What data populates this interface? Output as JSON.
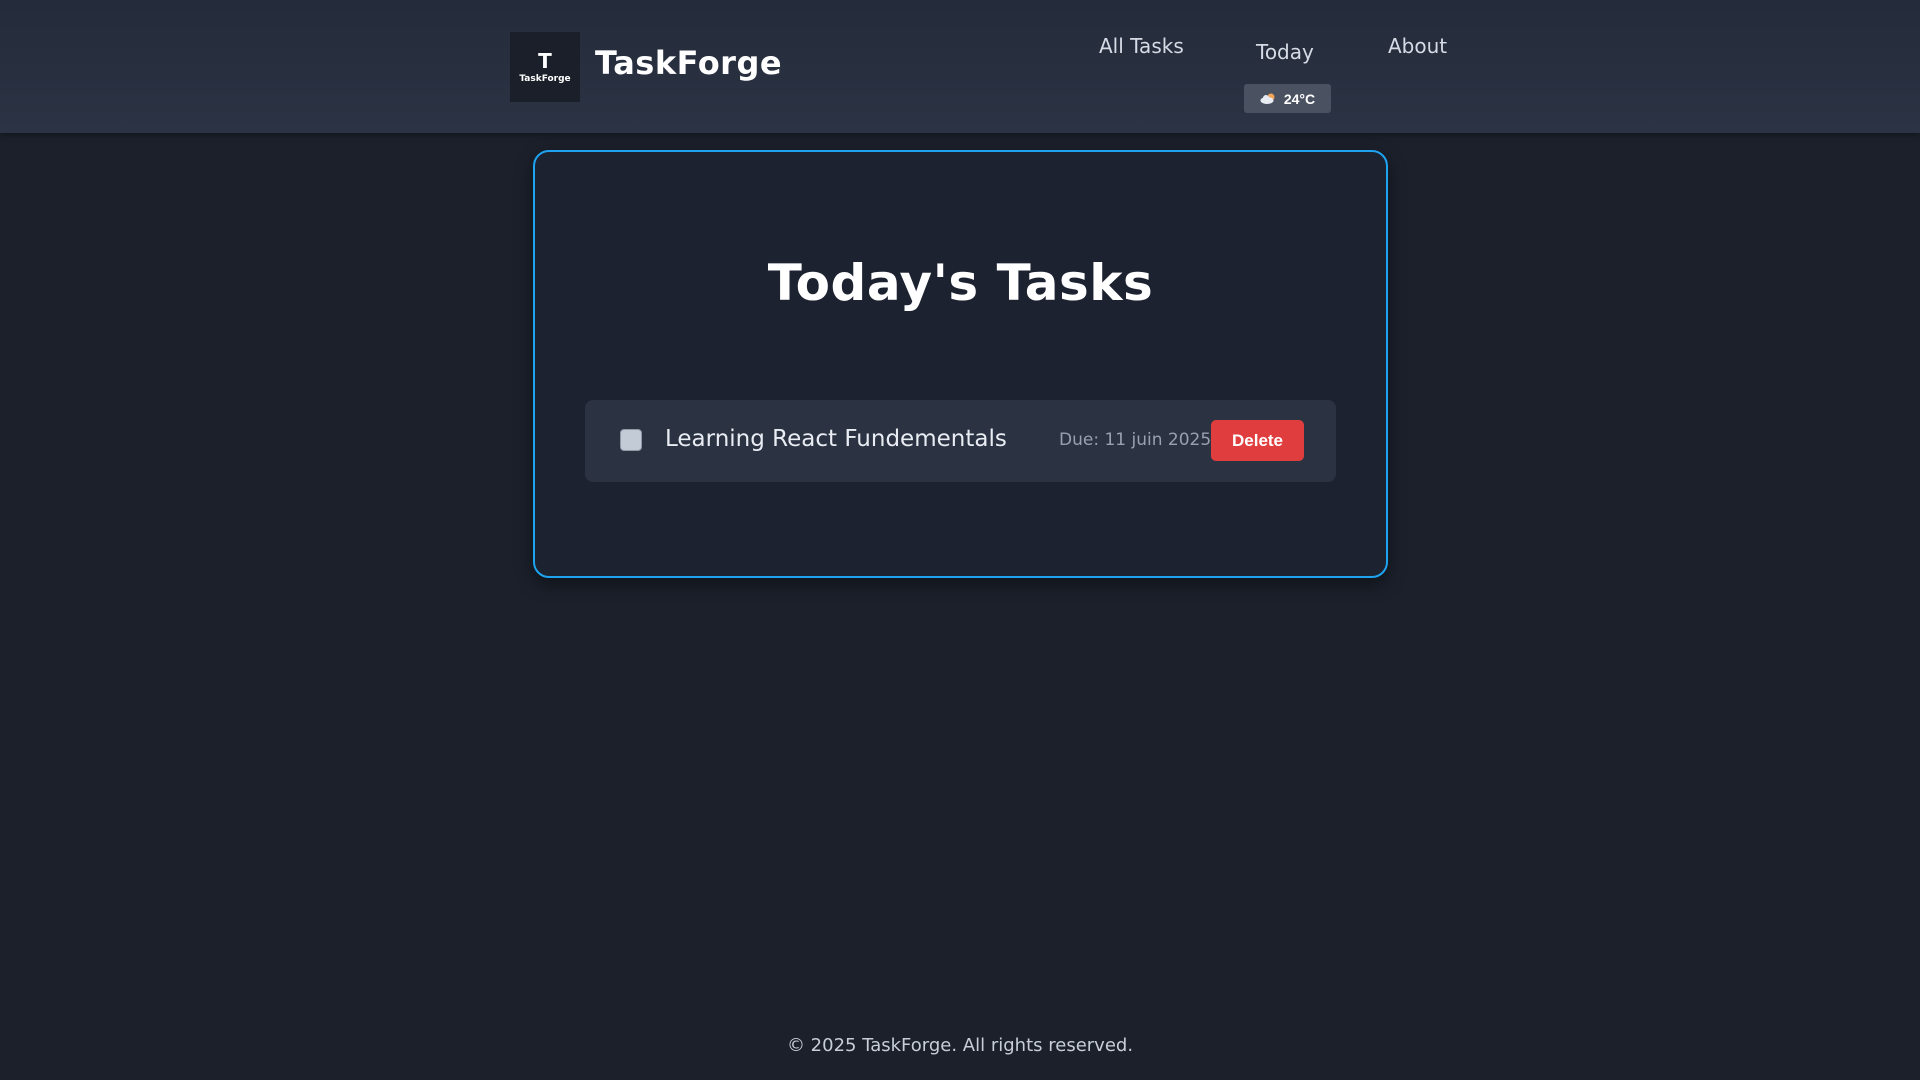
{
  "app": {
    "brand": "TaskForge",
    "logo_mark": "T",
    "logo_text": "TaskForge"
  },
  "nav": {
    "all_tasks": "All Tasks",
    "today": "Today",
    "about": "About"
  },
  "weather": {
    "icon": "cloud-sun-icon",
    "temperature": "24°C"
  },
  "main": {
    "title": "Today's Tasks",
    "tasks": [
      {
        "title": "Learning React Fundementals",
        "due": "Due: 11 juin 2025",
        "completed": false,
        "delete_label": "Delete"
      }
    ]
  },
  "footer": {
    "text": "© 2025 TaskForge. All rights reserved."
  },
  "colors": {
    "background": "#1b202b",
    "header": "#2b3344",
    "card_border": "#1ea3f0",
    "delete": "#e03e3e"
  }
}
